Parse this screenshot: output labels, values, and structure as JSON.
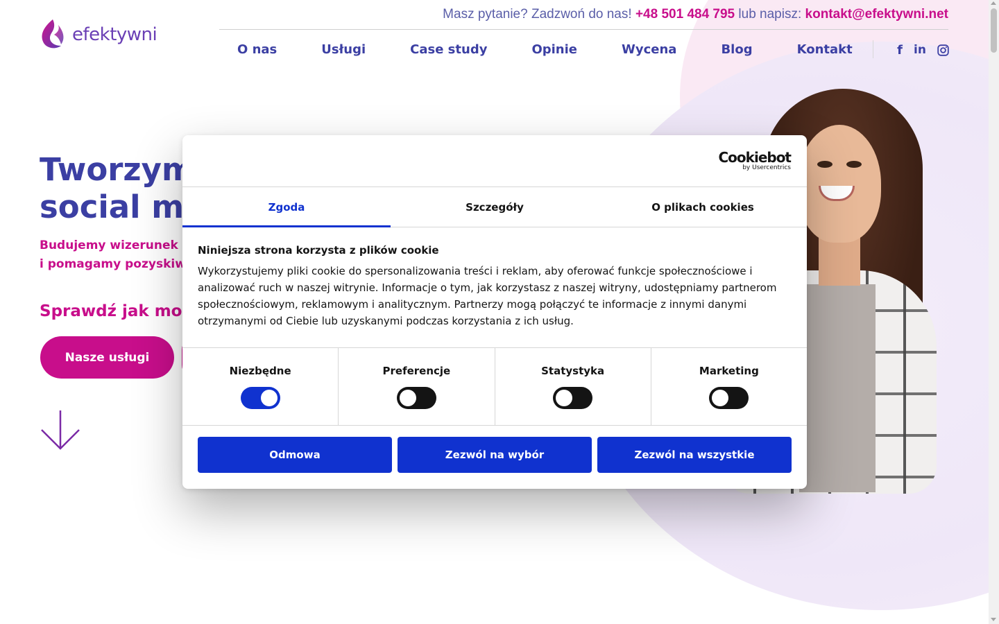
{
  "logo": {
    "text": "efektywni"
  },
  "topbar": {
    "question": "Masz pytanie? Zadzwoń do nas!",
    "phone": "+48 501 484 795",
    "or_write": "lub napisz:",
    "email": "kontakt@efektywni.net"
  },
  "nav": {
    "items": [
      "O nas",
      "Usługi",
      "Case study",
      "Opinie",
      "Wycena",
      "Blog",
      "Kontakt"
    ]
  },
  "social": {
    "facebook": "f",
    "linkedin": "in"
  },
  "hero": {
    "title_line1": "Tworzym",
    "title_line2": "social m",
    "sub_line1": "Budujemy wizerunek",
    "sub_line2": "i pomagamy pozyskiw",
    "check": "Sprawdź jak moż",
    "btn_services": "Nasze usługi"
  },
  "cookie": {
    "brand": "Cookiebot",
    "brand_sub": "by Usercentrics",
    "tabs": [
      "Zgoda",
      "Szczegóły",
      "O plikach cookies"
    ],
    "heading": "Niniejsza strona korzysta z plików cookie",
    "text": "Wykorzystujemy pliki cookie do spersonalizowania treści i reklam, aby oferować funkcje społecznościowe i analizować ruch w naszej witrynie. Informacje o tym, jak korzystasz z naszej witryny, udostępniamy partnerom społecznościowym, reklamowym i analitycznym. Partnerzy mogą połączyć te informacje z innymi danymi otrzymanymi od Ciebie lub uzyskanymi podczas korzystania z ich usług.",
    "categories": [
      {
        "label": "Niezbędne",
        "enabled": true
      },
      {
        "label": "Preferencje",
        "enabled": false
      },
      {
        "label": "Statystyka",
        "enabled": false
      },
      {
        "label": "Marketing",
        "enabled": false
      }
    ],
    "buttons": [
      "Odmowa",
      "Zezwól na wybór",
      "Zezwól na wszystkie"
    ]
  },
  "colors": {
    "brand_blue": "#3b3fa3",
    "brand_pink": "#c80e8b",
    "cookiebot_blue": "#1032cf"
  }
}
